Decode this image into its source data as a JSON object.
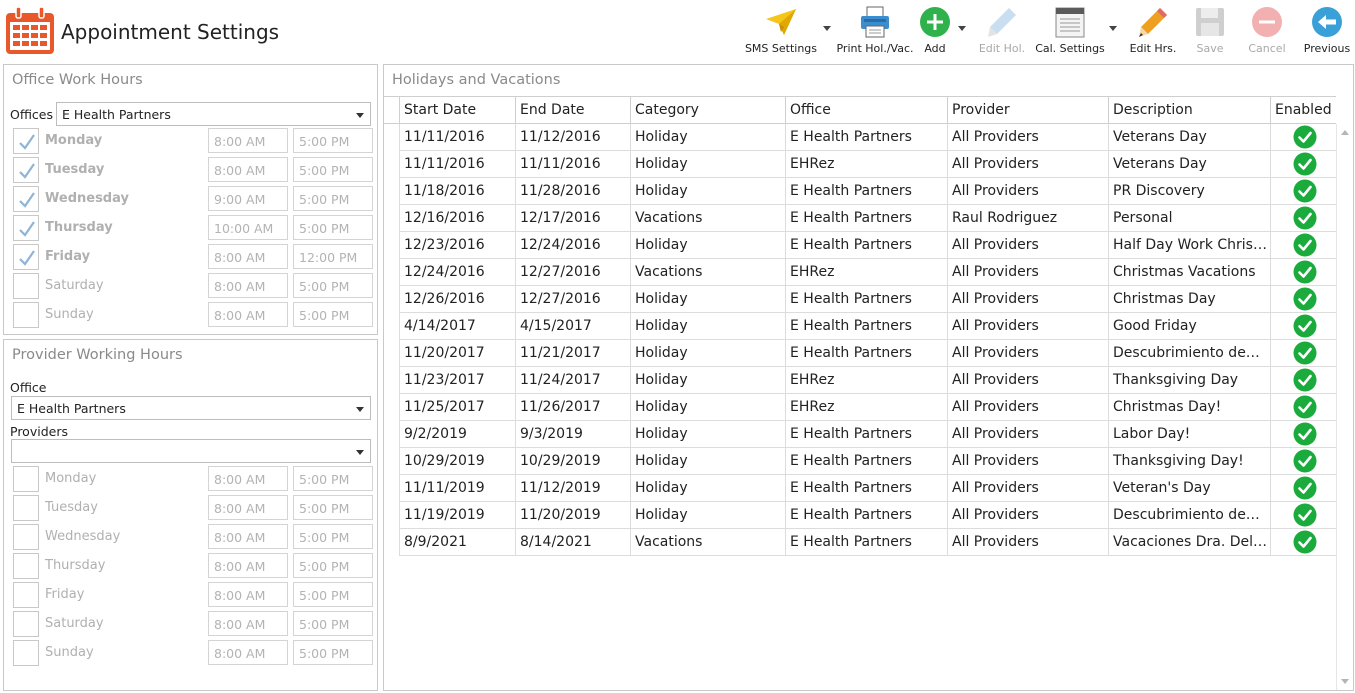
{
  "app": {
    "title": "Appointment Settings"
  },
  "toolbar": [
    {
      "name": "sms-settings-button",
      "icon": "paper-plane-icon",
      "label": "SMS Settings",
      "enabled": true,
      "dropdown": true
    },
    {
      "name": "print-holidays-button",
      "icon": "printer-icon",
      "label": "Print Hol./Vac.",
      "enabled": true,
      "dropdown": false
    },
    {
      "name": "add-button",
      "icon": "plus-circle-icon",
      "label": "Add",
      "enabled": true,
      "dropdown": true
    },
    {
      "name": "edit-holiday-button",
      "icon": "pencil-icon",
      "label": "Edit Hol.",
      "enabled": false,
      "dropdown": false
    },
    {
      "name": "calendar-settings-button",
      "icon": "notepad-icon",
      "label": "Cal. Settings",
      "enabled": true,
      "dropdown": true
    },
    {
      "name": "edit-hours-button",
      "icon": "pencil-icon",
      "label": "Edit Hrs.",
      "enabled": true,
      "dropdown": false
    },
    {
      "name": "save-button",
      "icon": "floppy-disk-icon",
      "label": "Save",
      "enabled": false,
      "dropdown": false
    },
    {
      "name": "cancel-button",
      "icon": "minus-circle-icon",
      "label": "Cancel",
      "enabled": false,
      "dropdown": false
    },
    {
      "name": "previous-button",
      "icon": "arrow-left-circle-icon",
      "label": "Previous",
      "enabled": true,
      "dropdown": false
    }
  ],
  "office_hours": {
    "title": "Office Work Hours",
    "offices_label": "Offices",
    "office_selected": "E Health Partners",
    "days": [
      {
        "day": "Monday",
        "checked": true,
        "start": "8:00 AM",
        "end": "5:00 PM"
      },
      {
        "day": "Tuesday",
        "checked": true,
        "start": "8:00 AM",
        "end": "5:00 PM"
      },
      {
        "day": "Wednesday",
        "checked": true,
        "start": "9:00 AM",
        "end": "5:00 PM"
      },
      {
        "day": "Thursday",
        "checked": true,
        "start": "10:00 AM",
        "end": "5:00 PM"
      },
      {
        "day": "Friday",
        "checked": true,
        "start": "8:00 AM",
        "end": "12:00 PM"
      },
      {
        "day": "Saturday",
        "checked": false,
        "start": "8:00 AM",
        "end": "5:00 PM"
      },
      {
        "day": "Sunday",
        "checked": false,
        "start": "8:00 AM",
        "end": "5:00 PM"
      }
    ]
  },
  "provider_hours": {
    "title": "Provider Working Hours",
    "office_label": "Office",
    "office_selected": "E Health Partners",
    "providers_label": "Providers",
    "provider_selected": "",
    "days": [
      {
        "day": "Monday",
        "checked": false,
        "start": "8:00 AM",
        "end": "5:00 PM"
      },
      {
        "day": "Tuesday",
        "checked": false,
        "start": "8:00 AM",
        "end": "5:00 PM"
      },
      {
        "day": "Wednesday",
        "checked": false,
        "start": "8:00 AM",
        "end": "5:00 PM"
      },
      {
        "day": "Thursday",
        "checked": false,
        "start": "8:00 AM",
        "end": "5:00 PM"
      },
      {
        "day": "Friday",
        "checked": false,
        "start": "8:00 AM",
        "end": "5:00 PM"
      },
      {
        "day": "Saturday",
        "checked": false,
        "start": "8:00 AM",
        "end": "5:00 PM"
      },
      {
        "day": "Sunday",
        "checked": false,
        "start": "8:00 AM",
        "end": "5:00 PM"
      }
    ]
  },
  "holidays": {
    "title": "Holidays and Vacations",
    "columns": [
      "Start Date",
      "End Date",
      "Category",
      "Office",
      "Provider",
      "Description",
      "Enabled"
    ],
    "rows": [
      [
        "11/11/2016",
        "11/12/2016",
        "Holiday",
        "E Health Partners",
        "All Providers",
        "Veterans Day",
        true
      ],
      [
        "11/11/2016",
        "11/11/2016",
        "Holiday",
        "EHRez",
        "All Providers",
        "Veterans Day",
        true
      ],
      [
        "11/18/2016",
        "11/28/2016",
        "Holiday",
        "E Health Partners",
        "All Providers",
        "PR Discovery",
        true
      ],
      [
        "12/16/2016",
        "12/17/2016",
        "Vacations",
        "E Health Partners",
        "Raul Rodriguez",
        "Personal",
        true
      ],
      [
        "12/23/2016",
        "12/24/2016",
        "Holiday",
        "E Health Partners",
        "All Providers",
        "Half Day Work Chris…",
        true
      ],
      [
        "12/24/2016",
        "12/27/2016",
        "Vacations",
        "EHRez",
        "All Providers",
        "Christmas Vacations",
        true
      ],
      [
        "12/26/2016",
        "12/27/2016",
        "Holiday",
        "E Health Partners",
        "All Providers",
        "Christmas Day",
        true
      ],
      [
        "4/14/2017",
        "4/15/2017",
        "Holiday",
        "E Health Partners",
        "All Providers",
        "Good Friday",
        true
      ],
      [
        "11/20/2017",
        "11/21/2017",
        "Holiday",
        "E Health Partners",
        "All Providers",
        "Descubrimiento de…",
        true
      ],
      [
        "11/23/2017",
        "11/24/2017",
        "Holiday",
        "EHRez",
        "All Providers",
        "Thanksgiving Day",
        true
      ],
      [
        "11/25/2017",
        "11/26/2017",
        "Holiday",
        "EHRez",
        "All Providers",
        "Christmas Day!",
        true
      ],
      [
        "9/2/2019",
        "9/3/2019",
        "Holiday",
        "E Health Partners",
        "All Providers",
        "Labor Day!",
        true
      ],
      [
        "10/29/2019",
        "10/29/2019",
        "Holiday",
        "E Health Partners",
        "All Providers",
        "Thanksgiving Day!",
        true
      ],
      [
        "11/11/2019",
        "11/12/2019",
        "Holiday",
        "E Health Partners",
        "All Providers",
        "Veteran's Day",
        true
      ],
      [
        "11/19/2019",
        "11/20/2019",
        "Holiday",
        "E Health Partners",
        "All Providers",
        "Descubrimiento de…",
        true
      ],
      [
        "8/9/2021",
        "8/14/2021",
        "Vacations",
        "E Health Partners",
        "All Providers",
        "Vacaciones Dra. Del…",
        true
      ]
    ]
  },
  "colors": {
    "brand_orange": "#e8582a",
    "add_green": "#2fb24c",
    "check_green": "#1aab3c",
    "previous_blue": "#3aa0d8",
    "disabled_gray": "#c8c8c8"
  }
}
